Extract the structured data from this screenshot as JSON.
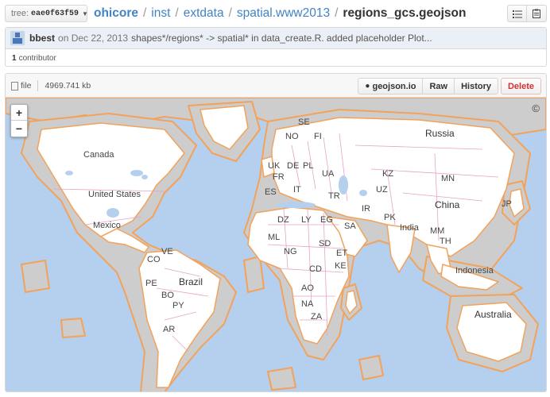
{
  "branch": {
    "prefix": "tree:",
    "name": "eae0f63f59"
  },
  "breadcrumb": {
    "repo": "ohicore",
    "path": [
      "inst",
      "extdata",
      "spatial.www2013"
    ],
    "file": "regions_gcs.geojson",
    "separator": "/"
  },
  "top_icons": [
    "list-icon",
    "clipboard-icon"
  ],
  "commit": {
    "author": "bbest",
    "meta": "on Dec 22, 2013",
    "message": "shapes*/regions* -> spatial* in data_create.R. added placeholder Plot...",
    "contributors_count": "1",
    "contributors_label": "contributor"
  },
  "file": {
    "type_label": "file",
    "size": "4969.741 kb",
    "actions": {
      "geojson": "geojson.io",
      "raw": "Raw",
      "history": "History",
      "delete": "Delete"
    }
  },
  "map": {
    "zoom_in": "+",
    "zoom_out": "−",
    "copyright": "©",
    "colors": {
      "ocean": "#b5d0ee",
      "land": "#ffffff",
      "buffer": "#cdcdcd",
      "outline": "#f2a25a",
      "borders": "#e8a0c8"
    },
    "labels": {
      "canada": "Canada",
      "us": "United States",
      "mexico": "Mexico",
      "co": "CO",
      "ve": "VE",
      "pe": "PE",
      "brazil": "Brazil",
      "bo": "BO",
      "py": "PY",
      "ar": "AR",
      "se": "SE",
      "no": "NO",
      "fi": "FI",
      "uk": "UK",
      "de": "DE",
      "pl": "PL",
      "fr": "FR",
      "ua": "UA",
      "es": "ES",
      "it": "IT",
      "tr": "TR",
      "russia": "Russia",
      "kz": "KZ",
      "mn": "MN",
      "uz": "UZ",
      "ir": "IR",
      "china": "China",
      "jp": "JP",
      "pk": "PK",
      "india": "India",
      "dz": "DZ",
      "ly": "LY",
      "eg": "EG",
      "sa": "SA",
      "ml": "ML",
      "ng": "NG",
      "sd": "SD",
      "et": "ET",
      "cd": "CD",
      "ke": "KE",
      "ao": "AO",
      "na": "NA",
      "za": "ZA",
      "mm": "MM",
      "th": "TH",
      "indonesia": "Indonesia",
      "australia": "Australia"
    }
  }
}
